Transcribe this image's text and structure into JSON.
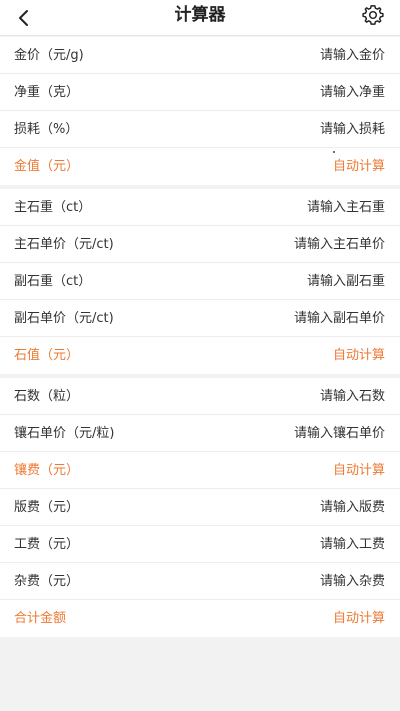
{
  "header": {
    "title": "计算器",
    "back_icon": "back-arrow-icon",
    "settings_icon": "gear-icon"
  },
  "colors": {
    "accent": "#EE7A33",
    "text": "#333333",
    "background": "#F2F2F2"
  },
  "gold_section": {
    "rows": [
      {
        "label": "金价（元/g)",
        "placeholder": "请输入金价"
      },
      {
        "label": "净重（克）",
        "placeholder": "请输入净重"
      },
      {
        "label": "损耗（%）",
        "placeholder": "请输入损耗"
      }
    ],
    "result": {
      "label": "金值（元）",
      "value": "自动计算"
    }
  },
  "stone_section": {
    "rows": [
      {
        "label": "主石重（ct）",
        "placeholder": "请输入主石重"
      },
      {
        "label": "主石单价（元/ct)",
        "placeholder": "请输入主石单价"
      },
      {
        "label": "副石重（ct）",
        "placeholder": "请输入副石重"
      },
      {
        "label": "副石单价（元/ct)",
        "placeholder": "请输入副石单价"
      }
    ],
    "result": {
      "label": "石值（元）",
      "value": "自动计算"
    }
  },
  "fee_section": {
    "rows": [
      {
        "label": "石数（粒）",
        "placeholder": "请输入石数"
      },
      {
        "label": "镶石单价（元/粒)",
        "placeholder": "请输入镶石单价"
      }
    ],
    "setting_fee": {
      "label": "镶费（元）",
      "value": "自动计算"
    },
    "rows2": [
      {
        "label": "版费（元）",
        "placeholder": "请输入版费"
      },
      {
        "label": "工费（元）",
        "placeholder": "请输入工费"
      },
      {
        "label": "杂费（元）",
        "placeholder": "请输入杂费"
      }
    ],
    "total": {
      "label": "合计金额",
      "value": "自动计算"
    }
  }
}
